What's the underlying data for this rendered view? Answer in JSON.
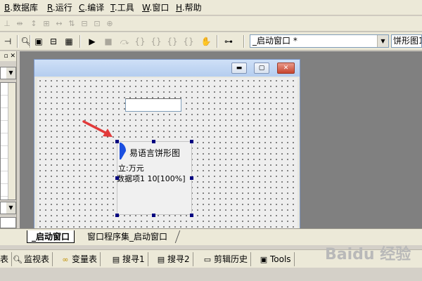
{
  "menubar": {
    "items": [
      {
        "mnemonic": "B",
        "label": ".数据库"
      },
      {
        "mnemonic": "R",
        "label": ".运行"
      },
      {
        "mnemonic": "C",
        "label": ".编译"
      },
      {
        "mnemonic": "T",
        "label": ".工具"
      },
      {
        "mnemonic": "W",
        "label": ".窗口"
      },
      {
        "mnemonic": "H",
        "label": ".帮助"
      }
    ]
  },
  "toolbar": {
    "window_selector": "_启动窗口 *",
    "control_selector": "饼形图1"
  },
  "form": {
    "pie_title": "易语言饼形图",
    "pie_unit": "立:万元",
    "pie_item": "数据项1 10[100%]"
  },
  "tabs": {
    "start_window": "_启动窗口",
    "program_set": "窗口程序集_启动窗口"
  },
  "bottom_tabs": {
    "prefix": "表",
    "watch": "监视表",
    "variables": "变量表",
    "search1": "搜寻1",
    "search2": "搜寻2",
    "clip_history": "剪辑历史",
    "tools": "Tools"
  },
  "watermark": "Baidu 经验",
  "colors": {
    "annotation_arrow": "#e23a3a",
    "selection_handle": "#000080",
    "pie_slice": "#1b4fe0"
  }
}
